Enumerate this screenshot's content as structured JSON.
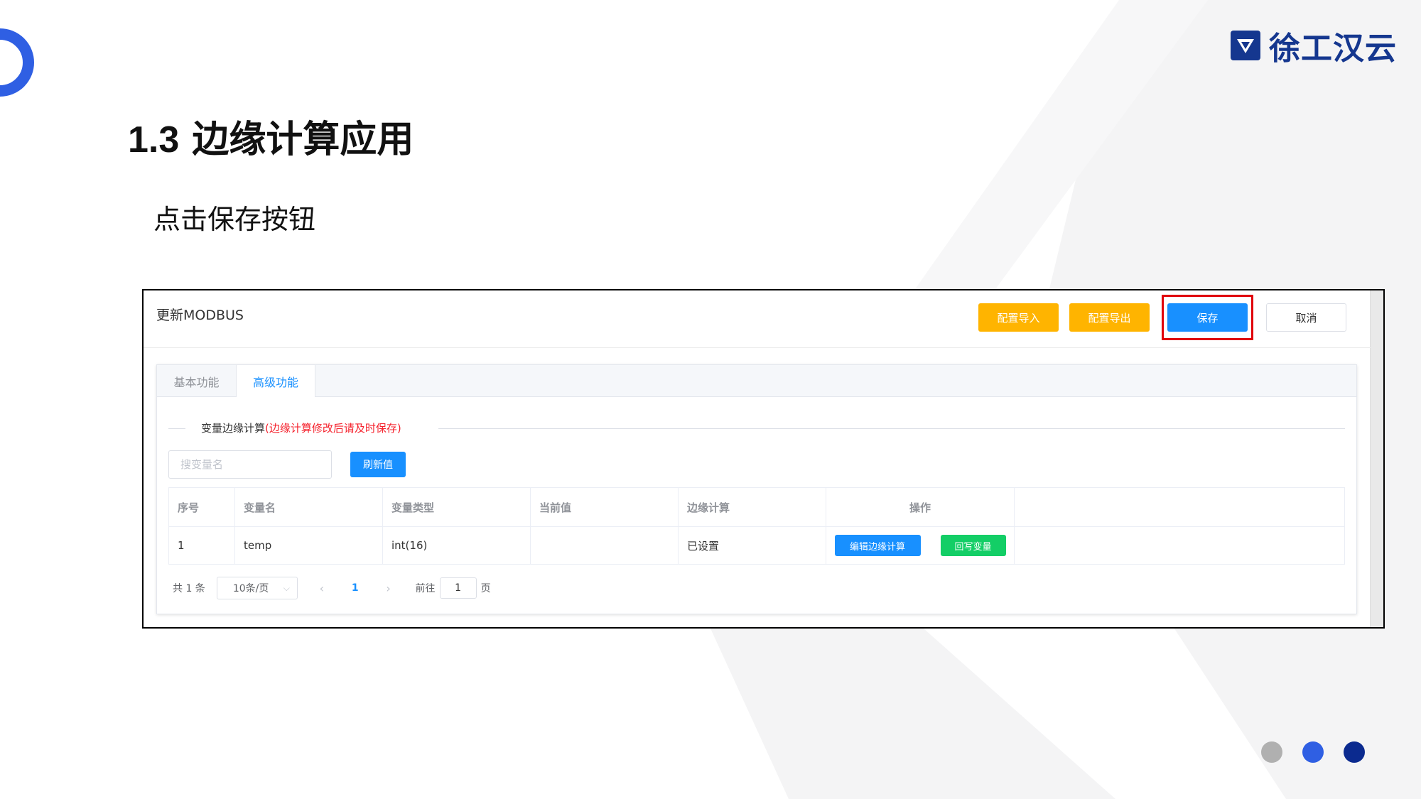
{
  "slide": {
    "title_num": "1.3",
    "title_text": "边缘计算应用",
    "subtitle": "点击保存按钮",
    "brand": "徐工汉云",
    "dot_colors": [
      "#b0b0b0",
      "#2f5fe3",
      "#0b2a8f"
    ]
  },
  "dialog": {
    "title": "更新MODBUS",
    "buttons": {
      "import": "配置导入",
      "export": "配置导出",
      "save": "保存",
      "cancel": "取消"
    },
    "tabs": [
      "基本功能",
      "高级功能"
    ],
    "section": {
      "label": "变量边缘计算",
      "warning": "(边缘计算修改后请及时保存)"
    },
    "search_placeholder": "搜变量名",
    "refresh_label": "刷新值",
    "table": {
      "headers": [
        "序号",
        "变量名",
        "变量类型",
        "当前值",
        "边缘计算",
        "操作"
      ],
      "rows": [
        {
          "index": "1",
          "name": "temp",
          "type": "int(16)",
          "value": "",
          "edge": "已设置",
          "edit_label": "编辑边缘计算",
          "write_label": "回写变量"
        }
      ]
    },
    "pagination": {
      "total": "共 1 条",
      "page_size": "10条/页",
      "current": "1",
      "goto_label": "前往",
      "goto_value": "1",
      "page_unit": "页"
    }
  },
  "colors": {
    "primary": "#1890ff",
    "warning_button": "#ffb400",
    "success": "#13ce66",
    "highlight": "#e0000b"
  }
}
